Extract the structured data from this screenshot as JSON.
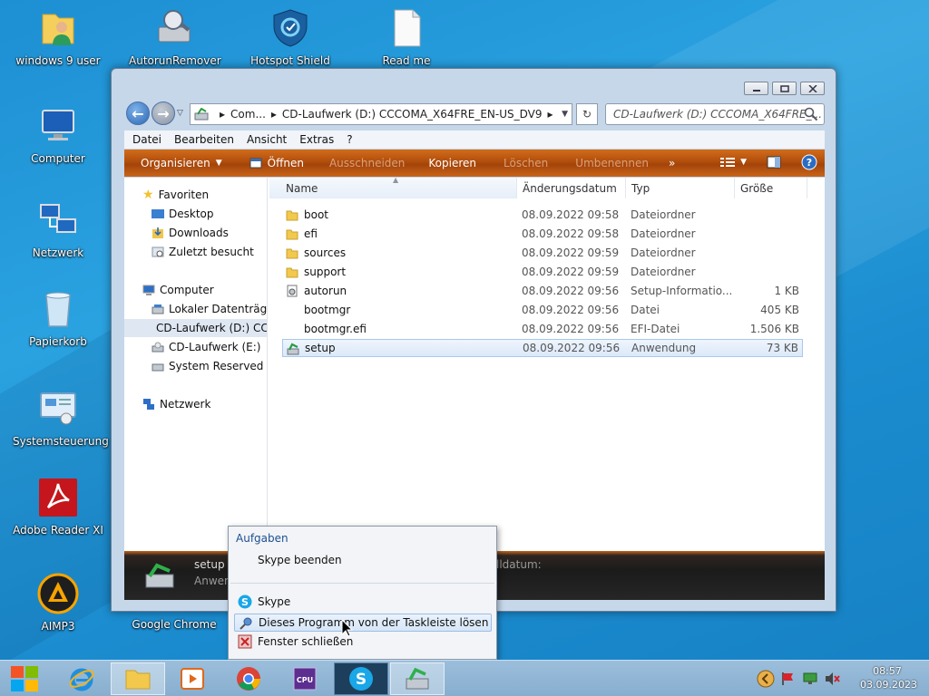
{
  "desktop": {
    "icons": [
      {
        "label": "windows 9 user",
        "icon": "user-folder-icon"
      },
      {
        "label": "AutorunRemover",
        "icon": "drive-tool-icon"
      },
      {
        "label": "Hotspot Shield",
        "icon": "shield-icon"
      },
      {
        "label": "Read me",
        "icon": "document-icon"
      },
      {
        "label": "Computer",
        "icon": "computer-icon"
      },
      {
        "label": "Netzwerk",
        "icon": "network-icon"
      },
      {
        "label": "Papierkorb",
        "icon": "recycle-bin-icon"
      },
      {
        "label": "Systemsteuerung",
        "icon": "control-panel-icon"
      },
      {
        "label": "Adobe Reader XI",
        "icon": "pdf-icon"
      },
      {
        "label": "AIMP3",
        "icon": "aimp-icon"
      },
      {
        "label": "Google Chrome",
        "icon": "chrome-icon"
      }
    ]
  },
  "explorer": {
    "address": {
      "segments": [
        "Com...",
        "CD-Laufwerk (D:) CCCOMA_X64FRE_EN-US_DV9"
      ],
      "search_placeholder": "CD-Laufwerk (D:) CCCOMA_X64FRE_..."
    },
    "menubar": [
      "Datei",
      "Bearbeiten",
      "Ansicht",
      "Extras",
      "?"
    ],
    "toolbar": {
      "organize": "Organisieren",
      "open": "Öffnen",
      "cut": "Ausschneiden",
      "copy": "Kopieren",
      "delete": "Löschen",
      "rename": "Umbenennen",
      "more": "»"
    },
    "nav": {
      "favorites": "Favoriten",
      "desktop": "Desktop",
      "downloads": "Downloads",
      "recent": "Zuletzt besucht",
      "computer": "Computer",
      "local": "Lokaler Datenträger",
      "cd_d": "CD-Laufwerk (D:) CC",
      "cd_e": "CD-Laufwerk (E:)",
      "reserved": "System Reserved (F:)",
      "network": "Netzwerk"
    },
    "columns": {
      "name": "Name",
      "date": "Änderungsdatum",
      "type": "Typ",
      "size": "Größe"
    },
    "files": [
      {
        "name": "boot",
        "date": "08.09.2022 09:58",
        "type": "Dateiordner",
        "size": "",
        "icon": "folder-icon"
      },
      {
        "name": "efi",
        "date": "08.09.2022 09:58",
        "type": "Dateiordner",
        "size": "",
        "icon": "folder-icon"
      },
      {
        "name": "sources",
        "date": "08.09.2022 09:59",
        "type": "Dateiordner",
        "size": "",
        "icon": "folder-icon"
      },
      {
        "name": "support",
        "date": "08.09.2022 09:59",
        "type": "Dateiordner",
        "size": "",
        "icon": "folder-icon"
      },
      {
        "name": "autorun",
        "date": "08.09.2022 09:56",
        "type": "Setup-Informatio...",
        "size": "1 KB",
        "icon": "setup-info-icon"
      },
      {
        "name": "bootmgr",
        "date": "08.09.2022 09:56",
        "type": "Datei",
        "size": "405 KB",
        "icon": "file-icon"
      },
      {
        "name": "bootmgr.efi",
        "date": "08.09.2022 09:56",
        "type": "EFI-Datei",
        "size": "1.506 KB",
        "icon": "file-icon"
      },
      {
        "name": "setup",
        "date": "08.09.2022 09:56",
        "type": "Anwendung",
        "size": "73 KB",
        "icon": "setup-app-icon"
      }
    ],
    "details": {
      "name": "setup",
      "type": "Anwen",
      "date_label": "lldatum:"
    }
  },
  "context_menu": {
    "header": "Aufgaben",
    "items": {
      "quit": "Skype beenden",
      "app": "Skype",
      "unpin": "Dieses Programm von der Taskleiste lösen",
      "close": "Fenster schließen"
    }
  },
  "taskbar": {
    "clock_time": "08:57",
    "clock_date": "03.09.2023"
  }
}
